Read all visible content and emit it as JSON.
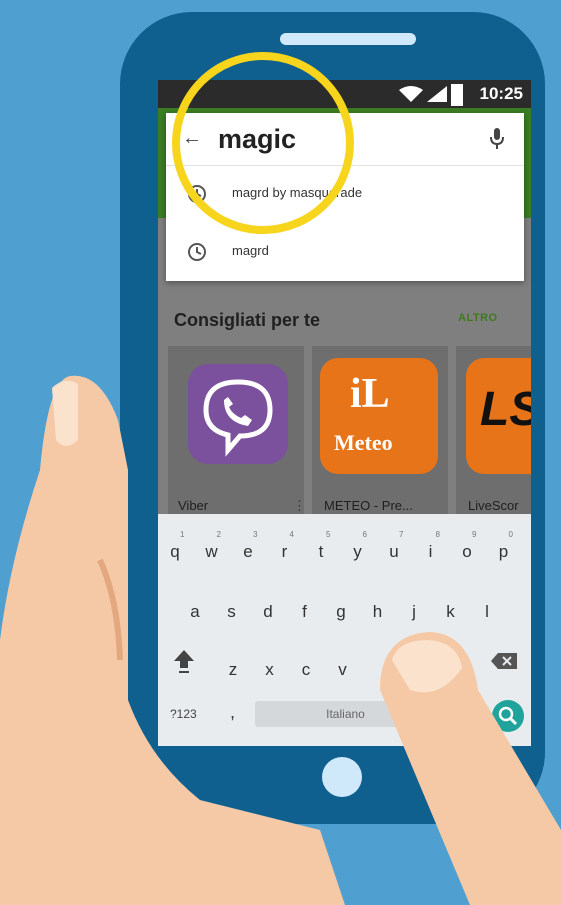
{
  "colors": {
    "background": "#4f9fd0",
    "phone_body": "#0f5f8f",
    "highlight": "#f7d51c",
    "accent_green": "#3f7b1e",
    "enter_key": "#1fa39a",
    "skin": "#f6c9a6"
  },
  "status_bar": {
    "time": "10:25",
    "icons": [
      "wifi-icon",
      "signal-icon",
      "battery-icon"
    ]
  },
  "search": {
    "back_icon": "arrow-left-icon",
    "query": "magic",
    "mic_icon": "microphone-icon",
    "suggestions": [
      {
        "icon": "history-icon",
        "text": "magrd by masquerade"
      },
      {
        "icon": "history-icon",
        "text": "magrd"
      }
    ]
  },
  "recommended": {
    "title": "Consigliati per te",
    "more_label": "ALTRO",
    "apps": [
      {
        "name": "Viber",
        "icon": "viber-icon"
      },
      {
        "name": "METEO - Pre...",
        "icon": "meteo-icon",
        "logo_text_1": "iL",
        "logo_text_2": "Meteo"
      },
      {
        "name": "LiveScor",
        "icon": "livescore-icon",
        "logo_text": "LS"
      }
    ],
    "overflow_icon": "more-vert-icon"
  },
  "keyboard": {
    "row1": [
      "q",
      "w",
      "e",
      "r",
      "t",
      "y",
      "u",
      "i",
      "o",
      "p"
    ],
    "row1_numbers": [
      "1",
      "2",
      "3",
      "4",
      "5",
      "6",
      "7",
      "8",
      "9",
      "0"
    ],
    "row2": [
      "a",
      "s",
      "d",
      "f",
      "g",
      "h",
      "j",
      "k",
      "l"
    ],
    "row3": [
      "z",
      "x",
      "c",
      "v"
    ],
    "shift_icon": "shift-icon",
    "backspace_icon": "backspace-icon",
    "symbols_label": "?123",
    "comma": ",",
    "space_label": "Italiano",
    "enter_icon": "search-icon"
  }
}
